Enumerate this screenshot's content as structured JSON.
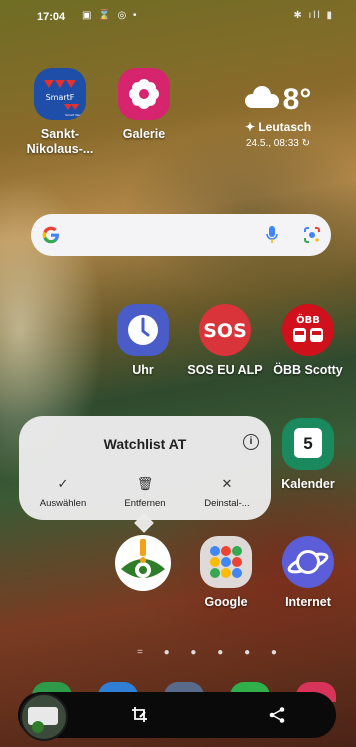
{
  "status_bar": {
    "time": "17:04",
    "left_icons": "▣ ⌛ ◎ •",
    "right_icons": "✱ ıll ▮"
  },
  "apps": {
    "sankt": {
      "label": "Sankt-\nNikolaus-...",
      "badge": "SmartF",
      "sub": "Smart Werk"
    },
    "galerie": {
      "label": "Galerie"
    },
    "uhr": {
      "label": "Uhr"
    },
    "sos": {
      "label": "SOS EU ALP",
      "icon_text": "SOS"
    },
    "obb": {
      "label": "ÖBB Scotty",
      "icon_text": "ÖBB"
    },
    "kalender": {
      "label": "Kalender",
      "icon_text": "5"
    },
    "watchlist": {
      "label": ""
    },
    "google": {
      "label": "Google"
    },
    "internet": {
      "label": "Internet"
    }
  },
  "weather": {
    "temp": "8°",
    "location": "Leutasch",
    "updated": "24.5., 08:33"
  },
  "popup": {
    "title": "Watchlist AT",
    "actions": [
      {
        "label": "Auswählen",
        "glyph": "✓"
      },
      {
        "label": "Entfernen",
        "glyph": "🗑"
      },
      {
        "label": "Deinstal-...",
        "glyph": "✕"
      }
    ]
  },
  "page_dots": "= ● ● ● ● ●",
  "colors": {
    "galerie": "#d6246e",
    "uhr": "#4a5cc8",
    "sos": "#d9343a",
    "obb": "#d0101a",
    "kalender": "#1a8a5e",
    "internet": "#5b5ed8"
  }
}
